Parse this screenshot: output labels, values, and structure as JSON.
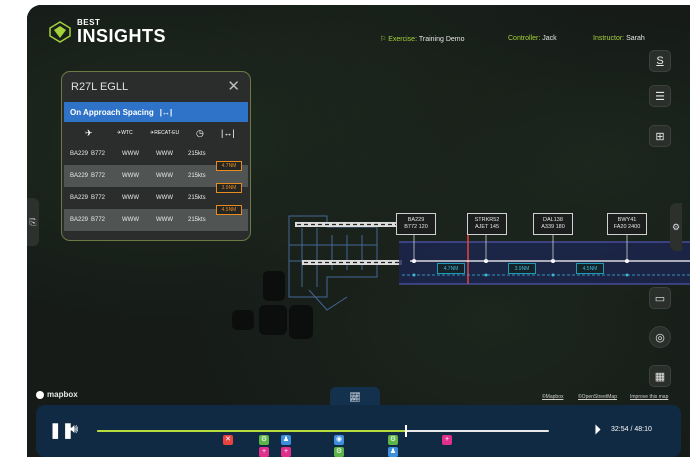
{
  "header": {
    "logo_small": "BEST",
    "logo_big": "INSIGHTS",
    "exercise_key": "Exercise:",
    "exercise_value": "Training Demo",
    "controller_key": "Controller:",
    "controller_value": "Jack",
    "instructor_key": "Instructor:",
    "instructor_value": "Sarah"
  },
  "right_toolbar": {
    "icons": [
      "signature-icon",
      "notes-icon",
      "clipboard-plus-icon",
      "gear-icon",
      "comment-icon",
      "compass-icon",
      "map-icon"
    ]
  },
  "panel": {
    "title": "R27L EGLL",
    "close": "✕",
    "section": "On Approach Spacing",
    "section_icon": "|↔|",
    "columns": [
      "✈",
      "WTC",
      "RECAT-EU",
      "◷",
      "|↔|"
    ],
    "rows": [
      {
        "callsign": "BA229",
        "type": "B772",
        "wtc": "WWW",
        "recat": "WWW",
        "speed": "215kts"
      },
      {
        "callsign": "BA229",
        "type": "B772",
        "wtc": "WWW",
        "recat": "WWW",
        "speed": "215kts"
      },
      {
        "callsign": "BA229",
        "type": "B772",
        "wtc": "WWW",
        "recat": "WWW",
        "speed": "215kts"
      },
      {
        "callsign": "BA229",
        "type": "B772",
        "wtc": "WWW",
        "recat": "WWW",
        "speed": "215kts"
      }
    ],
    "spacings": [
      "4.7NM",
      "3.9NM",
      "4.5NM"
    ]
  },
  "aircraft_labels": [
    {
      "l1": "BA229",
      "l2": "B772 120"
    },
    {
      "l1": "STRKR52",
      "l2": "AJET 145"
    },
    {
      "l1": "DAL138",
      "l2": "A339 180"
    },
    {
      "l1": "BWY41",
      "l2": "FA20 2400"
    }
  ],
  "distances": [
    "4.7NM",
    "3.9NM",
    "4.5NM"
  ],
  "map_footer": {
    "brand": "mapbox",
    "attr1": "©Mapbox",
    "attr2": "©OpenStreetMap",
    "attr3": "Improve this map"
  },
  "player": {
    "time": "32:54 / 48:10",
    "progress": 0.683,
    "colors": {
      "red": "#e8433f",
      "green": "#5cb546",
      "blue": "#3c8fdc",
      "pink": "#e0308d",
      "lime": "#b7dc3d"
    }
  }
}
